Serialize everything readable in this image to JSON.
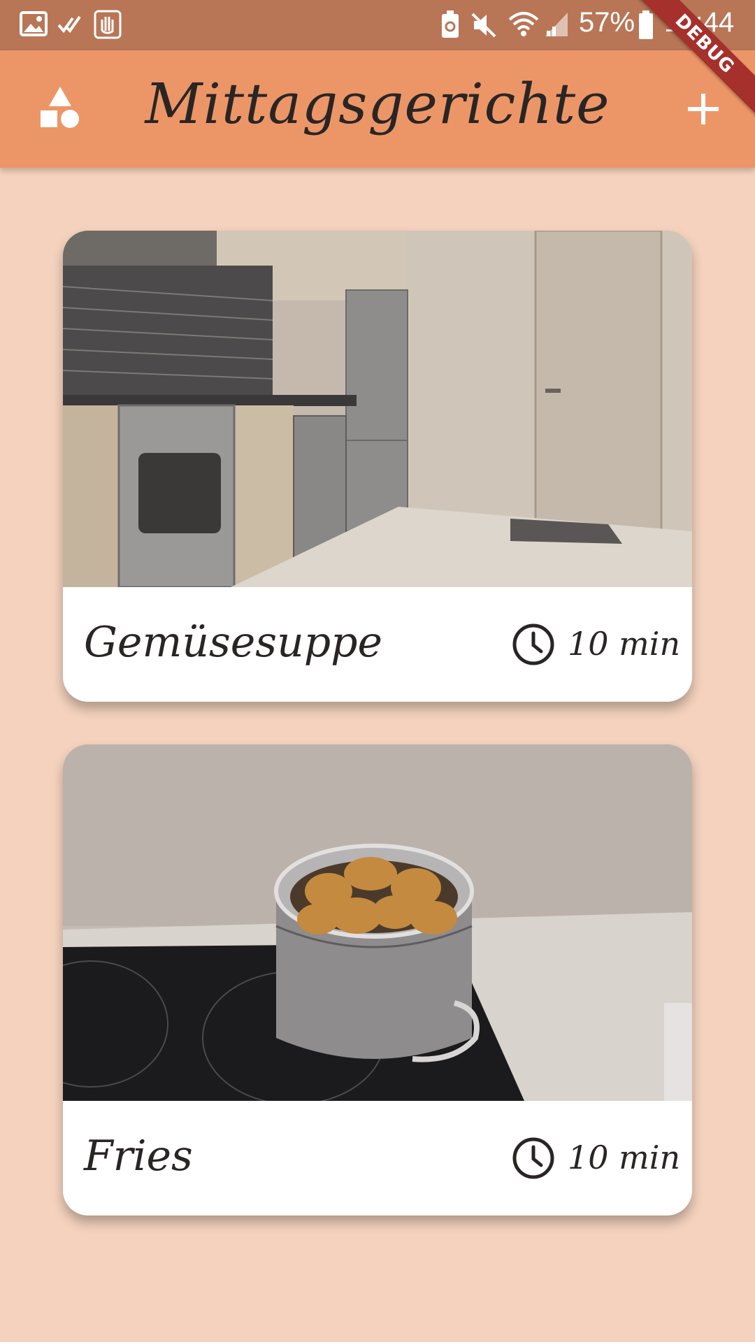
{
  "status_bar": {
    "battery_percent": "57%",
    "time": "10:44",
    "icons": [
      "image-icon",
      "checks-icon",
      "hand-icon",
      "battery-saver-icon",
      "mute-icon",
      "wifi-icon",
      "signal-icon",
      "battery-icon"
    ]
  },
  "debug_banner": "DEBUG",
  "app_bar": {
    "title": "Mittagsgerichte",
    "left_icon": "shapes-icon",
    "right_icon": "add-icon"
  },
  "recipes": [
    {
      "title": "Gemüsesuppe",
      "duration": "10 min",
      "image": "kitchen-photo"
    },
    {
      "title": "Fries",
      "duration": "10 min",
      "image": "pot-with-potatoes-photo"
    }
  ],
  "colors": {
    "status_bar": "#b87656",
    "app_bar": "#ec9667",
    "background": "#f4d2bd",
    "card": "#ffffff",
    "text": "#2a2525"
  }
}
